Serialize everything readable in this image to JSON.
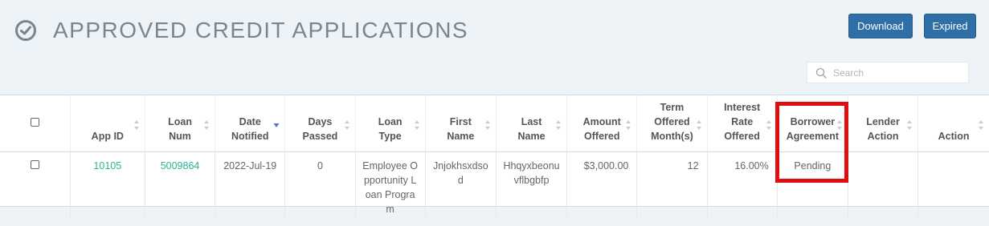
{
  "header": {
    "title": "APPROVED CREDIT APPLICATIONS",
    "icon": "check-circle-icon"
  },
  "toolbar": {
    "download_label": "Download",
    "expired_label": "Expired"
  },
  "search": {
    "placeholder": "Search",
    "value": ""
  },
  "colors": {
    "accent_button": "#2f6fa8",
    "link_green": "#2bb394",
    "highlight_red": "#e00d10"
  },
  "table": {
    "columns": [
      {
        "line1": "",
        "line2": "",
        "line3": ""
      },
      {
        "line1": "",
        "line2": "",
        "line3": "App ID"
      },
      {
        "line1": "",
        "line2": "Loan",
        "line3": "Num"
      },
      {
        "line1": "",
        "line2": "Date",
        "line3": "Notified"
      },
      {
        "line1": "",
        "line2": "Days",
        "line3": "Passed"
      },
      {
        "line1": "",
        "line2": "Loan",
        "line3": "Type"
      },
      {
        "line1": "",
        "line2": "First",
        "line3": "Name"
      },
      {
        "line1": "",
        "line2": "Last",
        "line3": "Name"
      },
      {
        "line1": "",
        "line2": "Amount",
        "line3": "Offered"
      },
      {
        "line1": "Term",
        "line2": "Offered",
        "line3": "Month(s)"
      },
      {
        "line1": "Interest",
        "line2": "Rate",
        "line3": "Offered"
      },
      {
        "line1": "",
        "line2": "Borrower",
        "line3": "Agreement"
      },
      {
        "line1": "",
        "line2": "Lender",
        "line3": "Action"
      },
      {
        "line1": "",
        "line2": "",
        "line3": "Action"
      }
    ],
    "rows": [
      {
        "app_id": "10105",
        "loan_num": "5009864",
        "date_notified": "2022-Jul-19",
        "days_passed": "0",
        "loan_type": "Employee Opportunity Loan Program",
        "first_name": "Jnjokhsxdsod",
        "last_name": "Hhqyxbeonuvflbgbfp",
        "amount_offered": "$3,000.00",
        "term_offered": "12",
        "interest_rate": "16.00%",
        "borrower_agreement": "Pending",
        "lender_action": "",
        "action": ""
      }
    ]
  }
}
